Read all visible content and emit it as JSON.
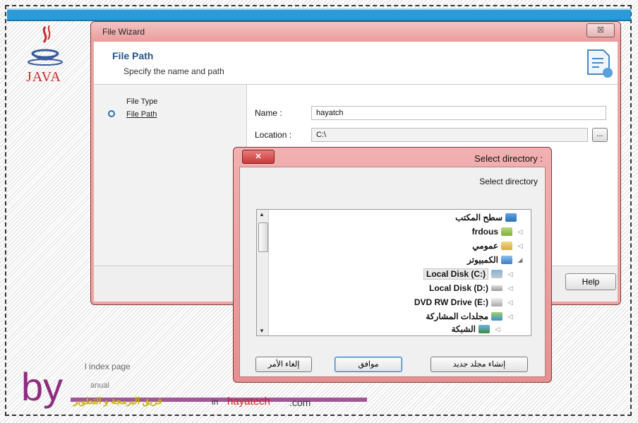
{
  "logo": {
    "text": "JAVA"
  },
  "wizard": {
    "title": "File Wizard",
    "close": "☒",
    "header_title": "File Path",
    "header_subtitle": "Specify the name and path",
    "steps": [
      "File Type",
      "File Path"
    ],
    "name_label": "Name :",
    "name_value": "hayatch",
    "location_label": "Location :",
    "location_value": "C:\\",
    "browse_label": "...",
    "help_label": "Help"
  },
  "dialog": {
    "close": "✕",
    "title": ": Select directory",
    "subtitle": "Select directory",
    "tree": [
      {
        "label": "سطح المكتب",
        "icon": "desktop-icon",
        "arrow": ""
      },
      {
        "label": "frdous",
        "icon": "user-folder-icon",
        "arrow": "◁"
      },
      {
        "label": "عمومي",
        "icon": "folder-icon",
        "arrow": "◁"
      },
      {
        "label": "الكمبيوتر",
        "icon": "computer-icon",
        "arrow": "◢"
      },
      {
        "label": "Local Disk (C:)",
        "icon": "drive-icon",
        "arrow": "◁"
      },
      {
        "label": "Local Disk (D:)",
        "icon": "drive-icon",
        "arrow": "◁"
      },
      {
        "label": "DVD RW Drive (E:)",
        "icon": "dvd-icon",
        "arrow": "◁"
      },
      {
        "label": "مجلدات المشاركة",
        "icon": "shared-folder-icon",
        "arrow": "◁"
      },
      {
        "label": "الشبكة",
        "icon": "network-icon",
        "arrow": "◁"
      }
    ],
    "buttons": {
      "new_folder": "إنشاء مجلد جديد",
      "ok": "موافق",
      "cancel": "إلغاء الأمر"
    }
  },
  "background": {
    "index_text": "l index page",
    "manual_text": "anual"
  },
  "watermark": {
    "by": "by",
    "team": "فريق البرمجة و التطوير",
    "in": "in",
    "site": "hayatech",
    "com": ".com"
  },
  "colors": {
    "accent": "#2a9ad8",
    "window_frame": "#ea9c9c",
    "brand": "#8e2d7e",
    "site": "#c71e1e"
  }
}
